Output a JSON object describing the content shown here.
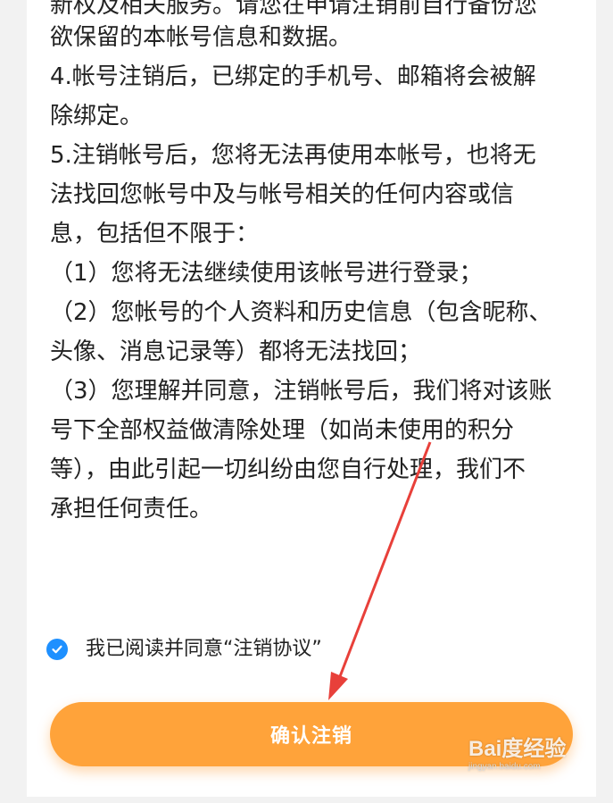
{
  "terms": {
    "clipped_top_line": "新权及相关服务。请您在申请注销前自行备份您",
    "paragraphs": [
      "欲保留的本帐号信息和数据。",
      "4.帐号注销后，已绑定的手机号、邮箱将会被解",
      "除绑定。",
      "5.注销帐号后，您将无法再使用本帐号，也将无",
      "法找回您帐号中及与帐号相关的任何内容或信",
      "息，包括但不限于：",
      "（1）您将无法继续使用该帐号进行登录；",
      "（2）您帐号的个人资料和历史信息（包含昵称、",
      "头像、消息记录等）都将无法找回；",
      "（3）您理解并同意，注销帐号后，我们将对该账",
      "号下全部权益做清除处理（如尚未使用的积分",
      "等），由此引起一切纠纷由您自行处理，我们不",
      "承担任何责任。"
    ]
  },
  "agreement": {
    "label": "我已阅读并同意“注销协议”",
    "checked": true,
    "check_icon": "check-circle-icon"
  },
  "confirm_button": {
    "label": "确认注销"
  },
  "watermark": {
    "logo": "Bai度经验",
    "url": "jingyan.baidu.com"
  },
  "colors": {
    "accent_orange": "#ffa33a",
    "checkbox_blue": "#1e90ff",
    "annotation_arrow": "#e8403a"
  }
}
